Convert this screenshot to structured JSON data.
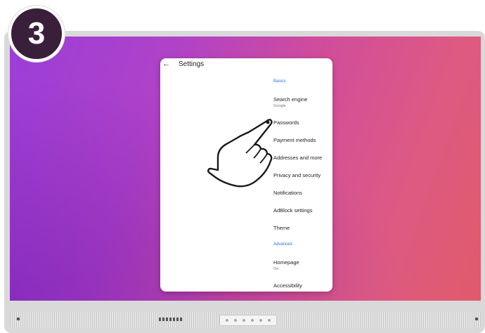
{
  "step_badge": "3",
  "settings": {
    "title": "Settings",
    "back_icon": "arrow-left-icon",
    "sections": {
      "basics": "Basics",
      "advanced": "Advanced"
    },
    "items": {
      "search_engine": {
        "label": "Search engine",
        "value": "Google"
      },
      "passwords": {
        "label": "Passwords"
      },
      "payment_methods": {
        "label": "Payment methods"
      },
      "addresses": {
        "label": "Addresses and more"
      },
      "privacy": {
        "label": "Privacy and security"
      },
      "notifications": {
        "label": "Notifications"
      },
      "adblock": {
        "label": "AdBlock settings"
      },
      "theme": {
        "label": "Theme"
      },
      "homepage": {
        "label": "Homepage",
        "value": "On"
      },
      "accessibility": {
        "label": "Accessibility"
      }
    }
  },
  "colors": {
    "badge_bg": "#3a1f3b",
    "section_header": "#2a6fd6",
    "wallpaper_left": "#9b3ed8",
    "wallpaper_right": "#e05a6a"
  },
  "pointer": "hand-pointer-icon"
}
